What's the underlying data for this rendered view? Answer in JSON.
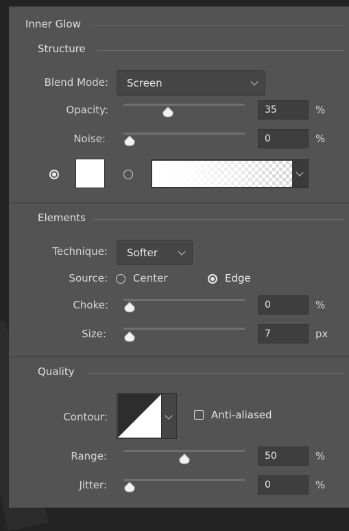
{
  "inner_glow": {
    "title": "Inner Glow",
    "structure": {
      "title": "Structure",
      "blend_mode_label": "Blend Mode:",
      "blend_mode_value": "Screen",
      "opacity_label": "Opacity:",
      "opacity_value": "35",
      "opacity_unit": "%",
      "opacity_fraction": 0.35,
      "noise_label": "Noise:",
      "noise_value": "0",
      "noise_unit": "%",
      "noise_fraction": 0,
      "color_swatch": "#ffffff",
      "color_radio_selected": true,
      "gradient_radio_selected": false
    },
    "elements": {
      "title": "Elements",
      "technique_label": "Technique:",
      "technique_value": "Softer",
      "source_label": "Source:",
      "source_center_label": "Center",
      "source_edge_label": "Edge",
      "source_selected": "Edge",
      "choke_label": "Choke:",
      "choke_value": "0",
      "choke_unit": "%",
      "choke_fraction": 0,
      "size_label": "Size:",
      "size_value": "7",
      "size_unit": "px"
    },
    "quality": {
      "title": "Quality",
      "contour_label": "Contour:",
      "anti_aliased_label": "Anti-aliased",
      "anti_aliased_checked": false,
      "range_label": "Range:",
      "range_value": "50",
      "range_unit": "%",
      "range_fraction": 0.5,
      "jitter_label": "Jitter:",
      "jitter_value": "0",
      "jitter_unit": "%",
      "jitter_fraction": 0
    }
  }
}
